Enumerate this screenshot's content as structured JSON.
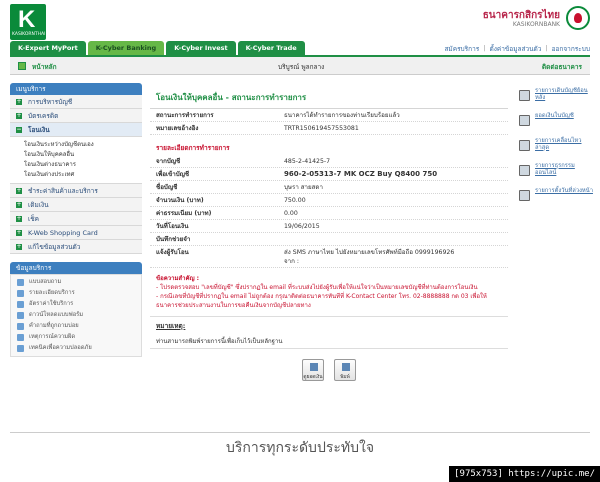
{
  "header": {
    "logo_letter": "K",
    "logo_sub": "KASIKORNTHAI",
    "bank_name": "ธนาคารกสิกรไทย",
    "bank_name_en": "KASIKORNBANK"
  },
  "tabs": [
    {
      "label": "K-Expert MyPort"
    },
    {
      "label": "K-Cyber Banking"
    },
    {
      "label": "K-Cyber Invest"
    },
    {
      "label": "K-Cyber Trade"
    }
  ],
  "top_links": [
    "สมัครบริการ",
    "ตั้งค่าข้อมูลส่วนตัว",
    "ออกจากระบบ"
  ],
  "homebar": {
    "home": "หน้าหลัก",
    "user": "บริบูรณ์ พูลกลาง",
    "contact": "ติดต่อธนาคาร"
  },
  "sidebar": {
    "menu_header": "เมนูบริการ",
    "items": [
      {
        "label": "การบริหารบัญชี"
      },
      {
        "label": "บัตรเครดิต"
      },
      {
        "label": "โอนเงิน"
      },
      {
        "label": "ชำระค่าสินค้าและบริการ"
      },
      {
        "label": "เติมเงิน"
      },
      {
        "label": "เช็ค"
      },
      {
        "label": "K-Web Shopping Card"
      },
      {
        "label": "แก้ไขข้อมูลส่วนตัว"
      }
    ],
    "submenu": [
      "โอนเงินระหว่างบัญชีตนเอง",
      "โอนเงินให้บุคคลอื่น",
      "โอนเงินต่างธนาคาร",
      "โอนเงินต่างประเทศ"
    ],
    "service_header": "ข้อมูลบริการ",
    "services": [
      "แบบสอบถาม",
      "รายละเอียดบริการ",
      "อัตราค่าใช้บริการ",
      "ดาวน์โหลดแบบฟอร์ม",
      "คำถามที่ถูกถามบ่อย",
      "เหตุการณ์ความผิด",
      "เทคนิคเพื่อความปลอดภัย"
    ]
  },
  "main": {
    "title": "โอนเงินให้บุคคลอื่น - สถานะการทำรายการ",
    "status_label": "สถานะการทำรายการ",
    "status_value": "ธนาคารได้ทำรายการของท่านเรียบร้อยแล้ว",
    "ref_label": "หมายเลขอ้างอิง",
    "ref_value": "TRTR150619457553081",
    "section_title": "รายละเอียดการทำรายการ",
    "details": [
      {
        "label": "จากบัญชี",
        "value": "485-2-41425-7",
        "bold": false
      },
      {
        "label": "เพื่อเข้าบัญชี",
        "value": "960-2-05313-7 MK OCZ Buy Q8400 750",
        "bold": true
      },
      {
        "label": "ชื่อบัญชี",
        "value": "บุษรา สายสดา",
        "bold": false
      },
      {
        "label": "จำนวนเงิน (บาท)",
        "value": "750.00",
        "bold": false
      },
      {
        "label": "ค่าธรรมเนียม (บาท)",
        "value": "0.00",
        "bold": false
      },
      {
        "label": "วันที่โอนเงิน",
        "value": "19/06/2015",
        "bold": false
      },
      {
        "label": "บันทึกช่วยจำ",
        "value": "",
        "bold": false
      }
    ],
    "notify_label": "แจ้งผู้รับโอน",
    "notify_value_1": "ส่ง SMS ภาษาไทย ไปยังหมายเลขโทรศัพท์มือถือ 0999196926",
    "notify_value_2": "จาก :",
    "note_title": "ข้อความสำคัญ :",
    "note_1": "- โปรดตรวจสอบ \"เลขที่บัญชี\" ซึ่งปรากฏใน email ที่ระบบส่งไปยังผู้รับเพื่อให้แน่ใจว่าเป็นหมายเลขบัญชีที่ท่านต้องการโอนเงิน",
    "note_2": "- กรณีเลขที่บัญชีที่ปรากฏใน email ไม่ถูกต้อง กรุณาติดต่อธนาคารทันทีที่ K-Contact Center โทร. 02-8888888 กด 03 เพื่อให้ธนาคารช่วยประสานงานในการขอคืนเงินจากบัญชีปลายทาง",
    "remark_title": "หมายเหตุ:",
    "remark_line": "ท่านสามารถพิมพ์รายการนี้เพื่อเก็บไว้เป็นหลักฐาน",
    "btn_view": "ดูยอดเงิน",
    "btn_print": "พิมพ์"
  },
  "right": [
    {
      "label": "รายการเดินบัญชีย้อนหลัง"
    },
    {
      "label": "ยอดเงินในบัญชี"
    },
    {
      "label": "รายการเคลื่อนไหวล่าสุด"
    },
    {
      "label": "รายการธุรกรรมออนไลน์"
    },
    {
      "label": "รายการตั้งวันที่ล่วงหน้า"
    }
  ],
  "footer": {
    "slogan": "บริการทุกระดับประทับใจ"
  },
  "watermark": "[975x753] https://upic.me/"
}
